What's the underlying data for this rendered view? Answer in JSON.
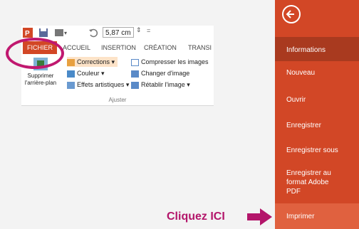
{
  "ribbon": {
    "zoom_value": "5,87 cm",
    "tabs": {
      "fichier": "FICHIER",
      "accueil": "ACCUEIL",
      "insertion": "INSERTION",
      "creation": "CRÉATION",
      "transitions": "TRANSI"
    },
    "remove_bg_line1": "Supprimer",
    "remove_bg_line2": "l'arrière-plan",
    "corrections": "Corrections",
    "couleur": "Couleur",
    "effets": "Effets artistiques",
    "compresser": "Compresser les images",
    "changer": "Changer d'image",
    "retablir": "Rétablir l'image",
    "group_label": "Ajuster"
  },
  "backstage": {
    "items": [
      {
        "label": "Informations"
      },
      {
        "label": "Nouveau"
      },
      {
        "label": "Ouvrir"
      },
      {
        "label": "Enregistrer"
      },
      {
        "label": "Enregistrer sous"
      },
      {
        "label_lines": [
          "Enregistrer au",
          "format Adobe",
          "PDF"
        ]
      },
      {
        "label": "Imprimer"
      }
    ]
  },
  "annotation": {
    "text": "Cliquez ICI"
  },
  "colors": {
    "accent": "#d24726",
    "active": "#a93a1f",
    "hover": "#e0613f",
    "highlight": "#c0186f",
    "annotation": "#b3156a"
  },
  "icons": [
    "powerpoint-icon",
    "save-icon",
    "undo-icon",
    "back-arrow-icon",
    "arrow-right-icon"
  ]
}
